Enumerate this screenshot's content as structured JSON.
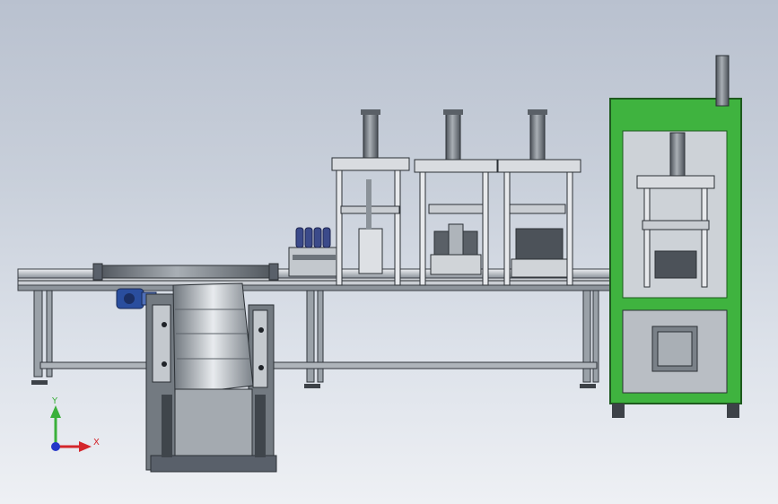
{
  "scene": {
    "background_top": "#b9c1cf",
    "background_bottom": "#eef0f4",
    "machine_colors": {
      "frame_steel": "#7f8790",
      "frame_dark": "#3a3f46",
      "cabinet_green": "#3fb33f",
      "cylinder_grey": "#6b7178",
      "base_plate": "#d6d9de"
    }
  },
  "triad": {
    "x_label": "X",
    "y_label": "Y",
    "x_color": "#d4262b",
    "y_color": "#3ab03a",
    "z_color": "#2436c8"
  }
}
